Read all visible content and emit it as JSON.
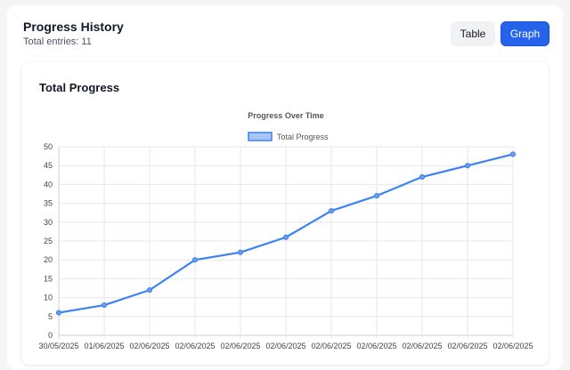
{
  "header": {
    "title": "Progress History",
    "subtitle": "Total entries: 11",
    "table_button": "Table",
    "graph_button": "Graph"
  },
  "card": {
    "title": "Total Progress"
  },
  "colors": {
    "accent": "#2563eb",
    "line": "#3b82f6",
    "point": "#6b9de8"
  },
  "chart_data": {
    "type": "line",
    "title": "Progress Over Time",
    "xlabel": "",
    "ylabel": "",
    "categories": [
      "30/05/2025",
      "01/06/2025",
      "02/06/2025",
      "02/06/2025",
      "02/06/2025",
      "02/06/2025",
      "02/06/2025",
      "02/06/2025",
      "02/06/2025",
      "02/06/2025",
      "02/06/2025"
    ],
    "series": [
      {
        "name": "Total Progress",
        "values": [
          6,
          8,
          12,
          20,
          22,
          26,
          33,
          37,
          42,
          45,
          48
        ]
      }
    ],
    "ylim": [
      0,
      50
    ],
    "yticks": [
      "0",
      "5",
      "10",
      "15",
      "20",
      "25",
      "30",
      "35",
      "40",
      "45",
      "50"
    ],
    "grid": true,
    "legend": "top-center"
  }
}
